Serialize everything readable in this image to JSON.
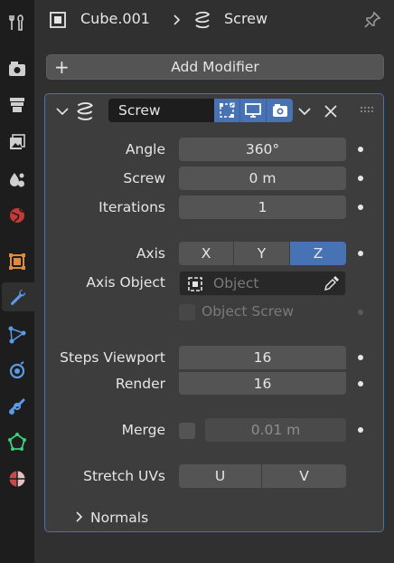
{
  "header": {
    "object_name": "Cube.001",
    "modifier_name": "Screw"
  },
  "add_modifier": {
    "label": "Add Modifier"
  },
  "modifier": {
    "name": "Screw",
    "fields": {
      "angle": {
        "label": "Angle",
        "value": "360°"
      },
      "screw": {
        "label": "Screw",
        "value": "0 m"
      },
      "iterations": {
        "label": "Iterations",
        "value": "1"
      },
      "axis": {
        "label": "Axis",
        "options": [
          "X",
          "Y",
          "Z"
        ],
        "selected": "Z"
      },
      "axis_object": {
        "label": "Axis Object",
        "placeholder": "Object"
      },
      "object_screw": {
        "label": "Object Screw"
      },
      "steps_viewport": {
        "label": "Steps Viewport",
        "value": "16"
      },
      "render": {
        "label": "Render",
        "value": "16"
      },
      "merge": {
        "label": "Merge",
        "value": "0.01 m"
      },
      "stretch_uvs": {
        "label": "Stretch UVs",
        "options": [
          "U",
          "V"
        ]
      }
    },
    "normals": {
      "label": "Normals"
    }
  },
  "colors": {
    "accent": "#4772b3",
    "panel": "#3d3d3d",
    "field": "#545454",
    "background": "#303030",
    "tabbar": "#1d1d1d"
  },
  "tabs": [
    "tool-icon",
    "render-icon",
    "output-icon",
    "view-layer-icon",
    "scene-icon",
    "world-icon",
    "object-icon",
    "modifier-icon",
    "particles-icon",
    "physics-icon",
    "constraints-icon",
    "data-icon",
    "material-icon"
  ]
}
